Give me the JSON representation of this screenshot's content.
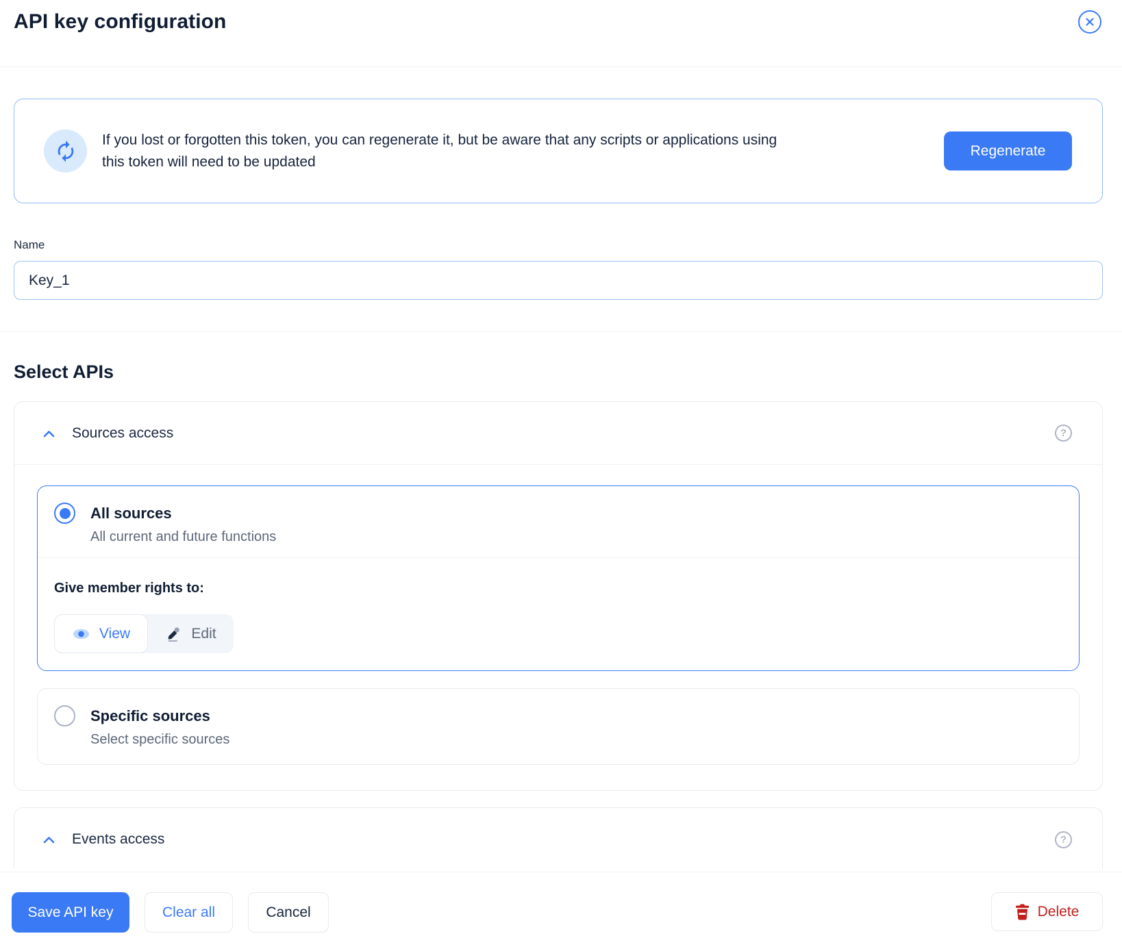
{
  "colors": {
    "primary_blue": "#3b7af5",
    "banner_border": "#8cb9f7",
    "icon_circle_bg": "#d9eafd",
    "text_dark": "#16233c",
    "text_gray": "#5d6879",
    "card_border": "#e7eaee",
    "divider": "#eef1f4",
    "delete_red": "#c0201e"
  },
  "header": {
    "title": "API key configuration"
  },
  "banner": {
    "message": "If you lost or forgotten this token, you can regenerate it, but be aware that any scripts or applications using this token will need to be updated",
    "regenerate_label": "Regenerate"
  },
  "name_field": {
    "label": "Name",
    "value": "Key_1"
  },
  "select_apis": {
    "heading": "Select APIs",
    "sources": {
      "title": "Sources access",
      "all_sources": {
        "title": "All sources",
        "subtitle": "All current and future functions",
        "selected": true
      },
      "rights_label": "Give member rights to:",
      "view_label": "View",
      "edit_label": "Edit",
      "selected_right": "View",
      "specific_sources": {
        "title": "Specific sources",
        "subtitle": "Select specific sources",
        "selected": false
      }
    },
    "events": {
      "title": "Events access"
    }
  },
  "footer": {
    "save_label": "Save API key",
    "clear_label": "Clear all",
    "cancel_label": "Cancel",
    "delete_label": "Delete"
  }
}
